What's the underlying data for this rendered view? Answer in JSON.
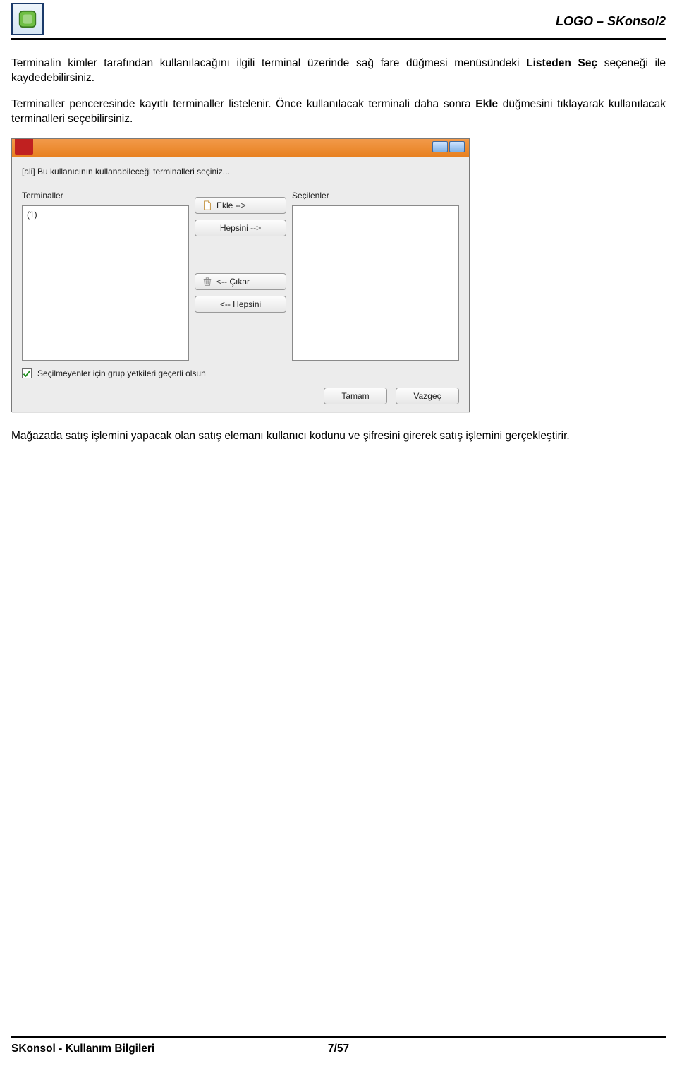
{
  "header": {
    "title": "LOGO – SKonsol2"
  },
  "body": {
    "para1_a": "Terminalin kimler tarafından kullanılacağını ilgili terminal üzerinde sağ fare düğmesi menüsündeki ",
    "para1_b": "Listeden Seç",
    "para1_c": " seçeneği ile kaydedebilirsiniz.",
    "para2_a": "Terminaller penceresinde kayıtlı terminaller listelenir. Önce kullanılacak terminali daha sonra ",
    "para2_b": "Ekle",
    "para2_c": " düğmesini tıklayarak kullanılacak terminalleri seçebilirsiniz.",
    "para3": "Mağazada satış işlemini yapacak olan satış elemanı kullanıcı kodunu ve şifresini girerek satış işlemini gerçekleştirir."
  },
  "dialog": {
    "instruction": "[ali] Bu kullanıcının kullanabileceği terminalleri seçiniz...",
    "left_label": "Terminaller",
    "right_label": "Seçilenler",
    "left_items": [
      "(1)"
    ],
    "buttons": {
      "add": "Ekle -->",
      "add_all": "Hepsini -->",
      "remove": "<-- Çıkar",
      "remove_all": "<-- Hepsini"
    },
    "checkbox_label": "Seçilmeyenler için grup yetkileri geçerli olsun",
    "checkbox_checked": true,
    "ok_u": "T",
    "ok_rest": "amam",
    "cancel_u": "V",
    "cancel_rest": "azgeç"
  },
  "footer": {
    "left": "SKonsol - Kullanım Bilgileri",
    "page": "7/57"
  }
}
